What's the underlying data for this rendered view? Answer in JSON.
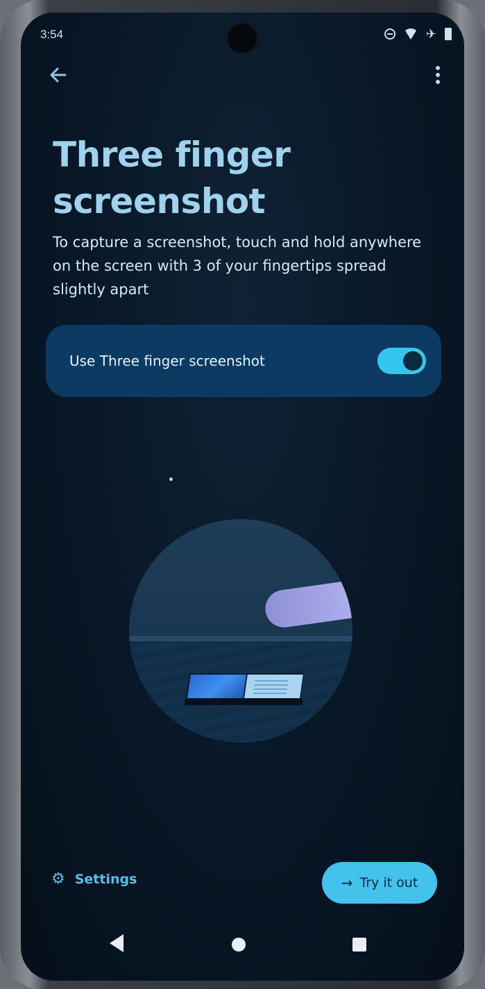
{
  "status_bar": {
    "time": "3:54",
    "icons": [
      "do-not-disturb-icon",
      "wifi-icon",
      "airplane-icon",
      "battery-icon"
    ]
  },
  "header": {
    "back_icon": "back-arrow-icon",
    "menu_icon": "more-vert-icon"
  },
  "page": {
    "title": "Three finger screenshot",
    "description": "To capture a screenshot, touch and hold anywhere on the screen with 3 of your fingertips spread slightly apart"
  },
  "toggle": {
    "label": "Use Three finger screenshot",
    "checked": true
  },
  "footer": {
    "settings_label": "Settings",
    "try_label": "Try it out"
  },
  "nav": {
    "back_icon": "nav-back-icon",
    "home_icon": "nav-home-icon",
    "recents_icon": "nav-recents-icon"
  },
  "colors": {
    "accent": "#43c2ec",
    "card": "#0d3a63",
    "background": "#081726",
    "title": "#9fd2ec"
  }
}
